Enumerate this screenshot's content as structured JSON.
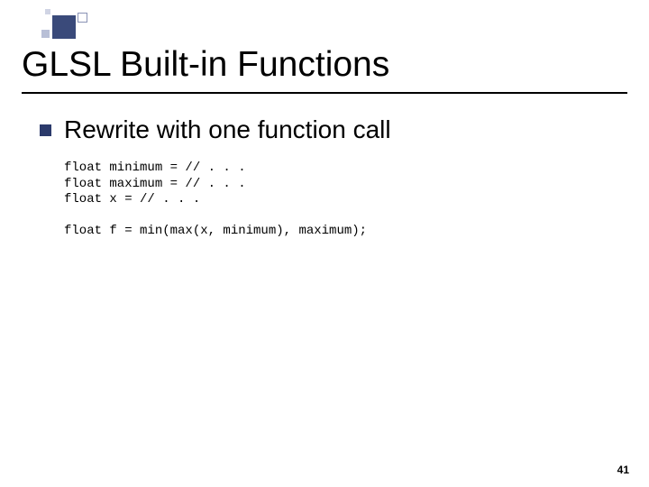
{
  "title": "GLSL Built-in Functions",
  "bullet": {
    "text": "Rewrite with one function call"
  },
  "code": {
    "line1": "float minimum = // . . .",
    "line2": "float maximum = // . . .",
    "line3": "float x = // . . .",
    "blank": "",
    "line4": "float f = min(max(x, minimum), maximum);"
  },
  "page_number": "41"
}
